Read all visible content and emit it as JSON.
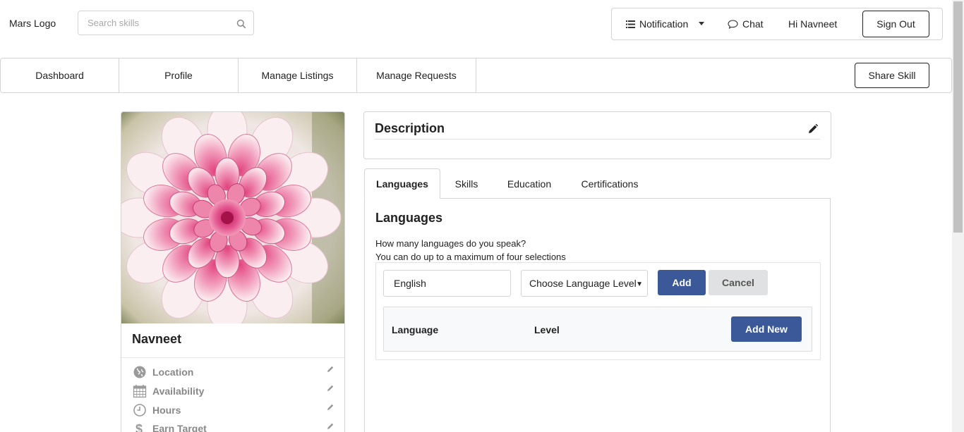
{
  "header": {
    "logo_text": "Mars Logo",
    "search_placeholder": "Search skills",
    "notification_label": "Notification",
    "chat_label": "Chat",
    "greeting": "Hi Navneet",
    "signout_label": "Sign Out"
  },
  "nav": {
    "tabs": [
      "Dashboard",
      "Profile",
      "Manage Listings",
      "Manage Requests"
    ],
    "share_label": "Share Skill"
  },
  "profile": {
    "name": "Navneet",
    "items": [
      {
        "label": "Location",
        "icon": "globe-icon"
      },
      {
        "label": "Availability",
        "icon": "calendar-icon"
      },
      {
        "label": "Hours",
        "icon": "clock-icon"
      },
      {
        "label": "Earn Target",
        "icon": "dollar-icon"
      }
    ]
  },
  "description": {
    "title": "Description"
  },
  "tabs": {
    "items": [
      "Languages",
      "Skills",
      "Education",
      "Certifications"
    ],
    "active": "Languages"
  },
  "languages": {
    "title": "Languages",
    "subtitle_line1": "How many languages do you speak?",
    "subtitle_line2": "You can do up to a maximum of four selections",
    "input_value": "English",
    "select_value": "Choose Language Level",
    "add_label": "Add",
    "cancel_label": "Cancel",
    "table": {
      "col_language": "Language",
      "col_level": "Level",
      "add_new_label": "Add New"
    }
  },
  "colors": {
    "primary_button": "#3b5998",
    "secondary_button": "#e0e1e2",
    "border": "#d4d4d5"
  }
}
